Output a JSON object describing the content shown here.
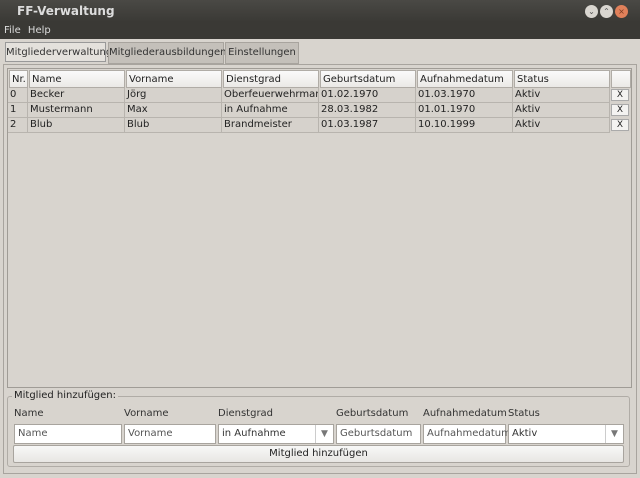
{
  "window": {
    "title": "FF-Verwaltung"
  },
  "menu": [
    "File",
    "Help"
  ],
  "tabs": [
    "Mitgliederverwaltung",
    "Mitgliederausbildungen",
    "Einstellungen"
  ],
  "table": {
    "headers": [
      "Nr.",
      "Name",
      "Vorname",
      "Dienstgrad",
      "Geburtsdatum",
      "Aufnahmedatum",
      "Status",
      ""
    ],
    "rows": [
      [
        "0",
        "Becker",
        "Jörg",
        "Oberfeuerwehrmann",
        "01.02.1970",
        "01.03.1970",
        "Aktiv",
        "X"
      ],
      [
        "1",
        "Mustermann",
        "Max",
        "in Aufnahme",
        "28.03.1982",
        "01.01.1970",
        "Aktiv",
        "X"
      ],
      [
        "2",
        "Blub",
        "Blub",
        "Brandmeister",
        "01.03.1987",
        "10.10.1999",
        "Aktiv",
        "X"
      ]
    ]
  },
  "add_form": {
    "title": "Mitglied hinzufügen:",
    "labels": [
      "Name",
      "Vorname",
      "Dienstgrad",
      "Geburtsdatum",
      "Aufnahmedatum",
      "Status"
    ],
    "fields": [
      "Name",
      "Vorname",
      "in Aufnahme",
      "Geburtsdatum",
      "Aufnahmedatum",
      "Aktiv"
    ],
    "button": "Mitglied hinzufügen"
  }
}
